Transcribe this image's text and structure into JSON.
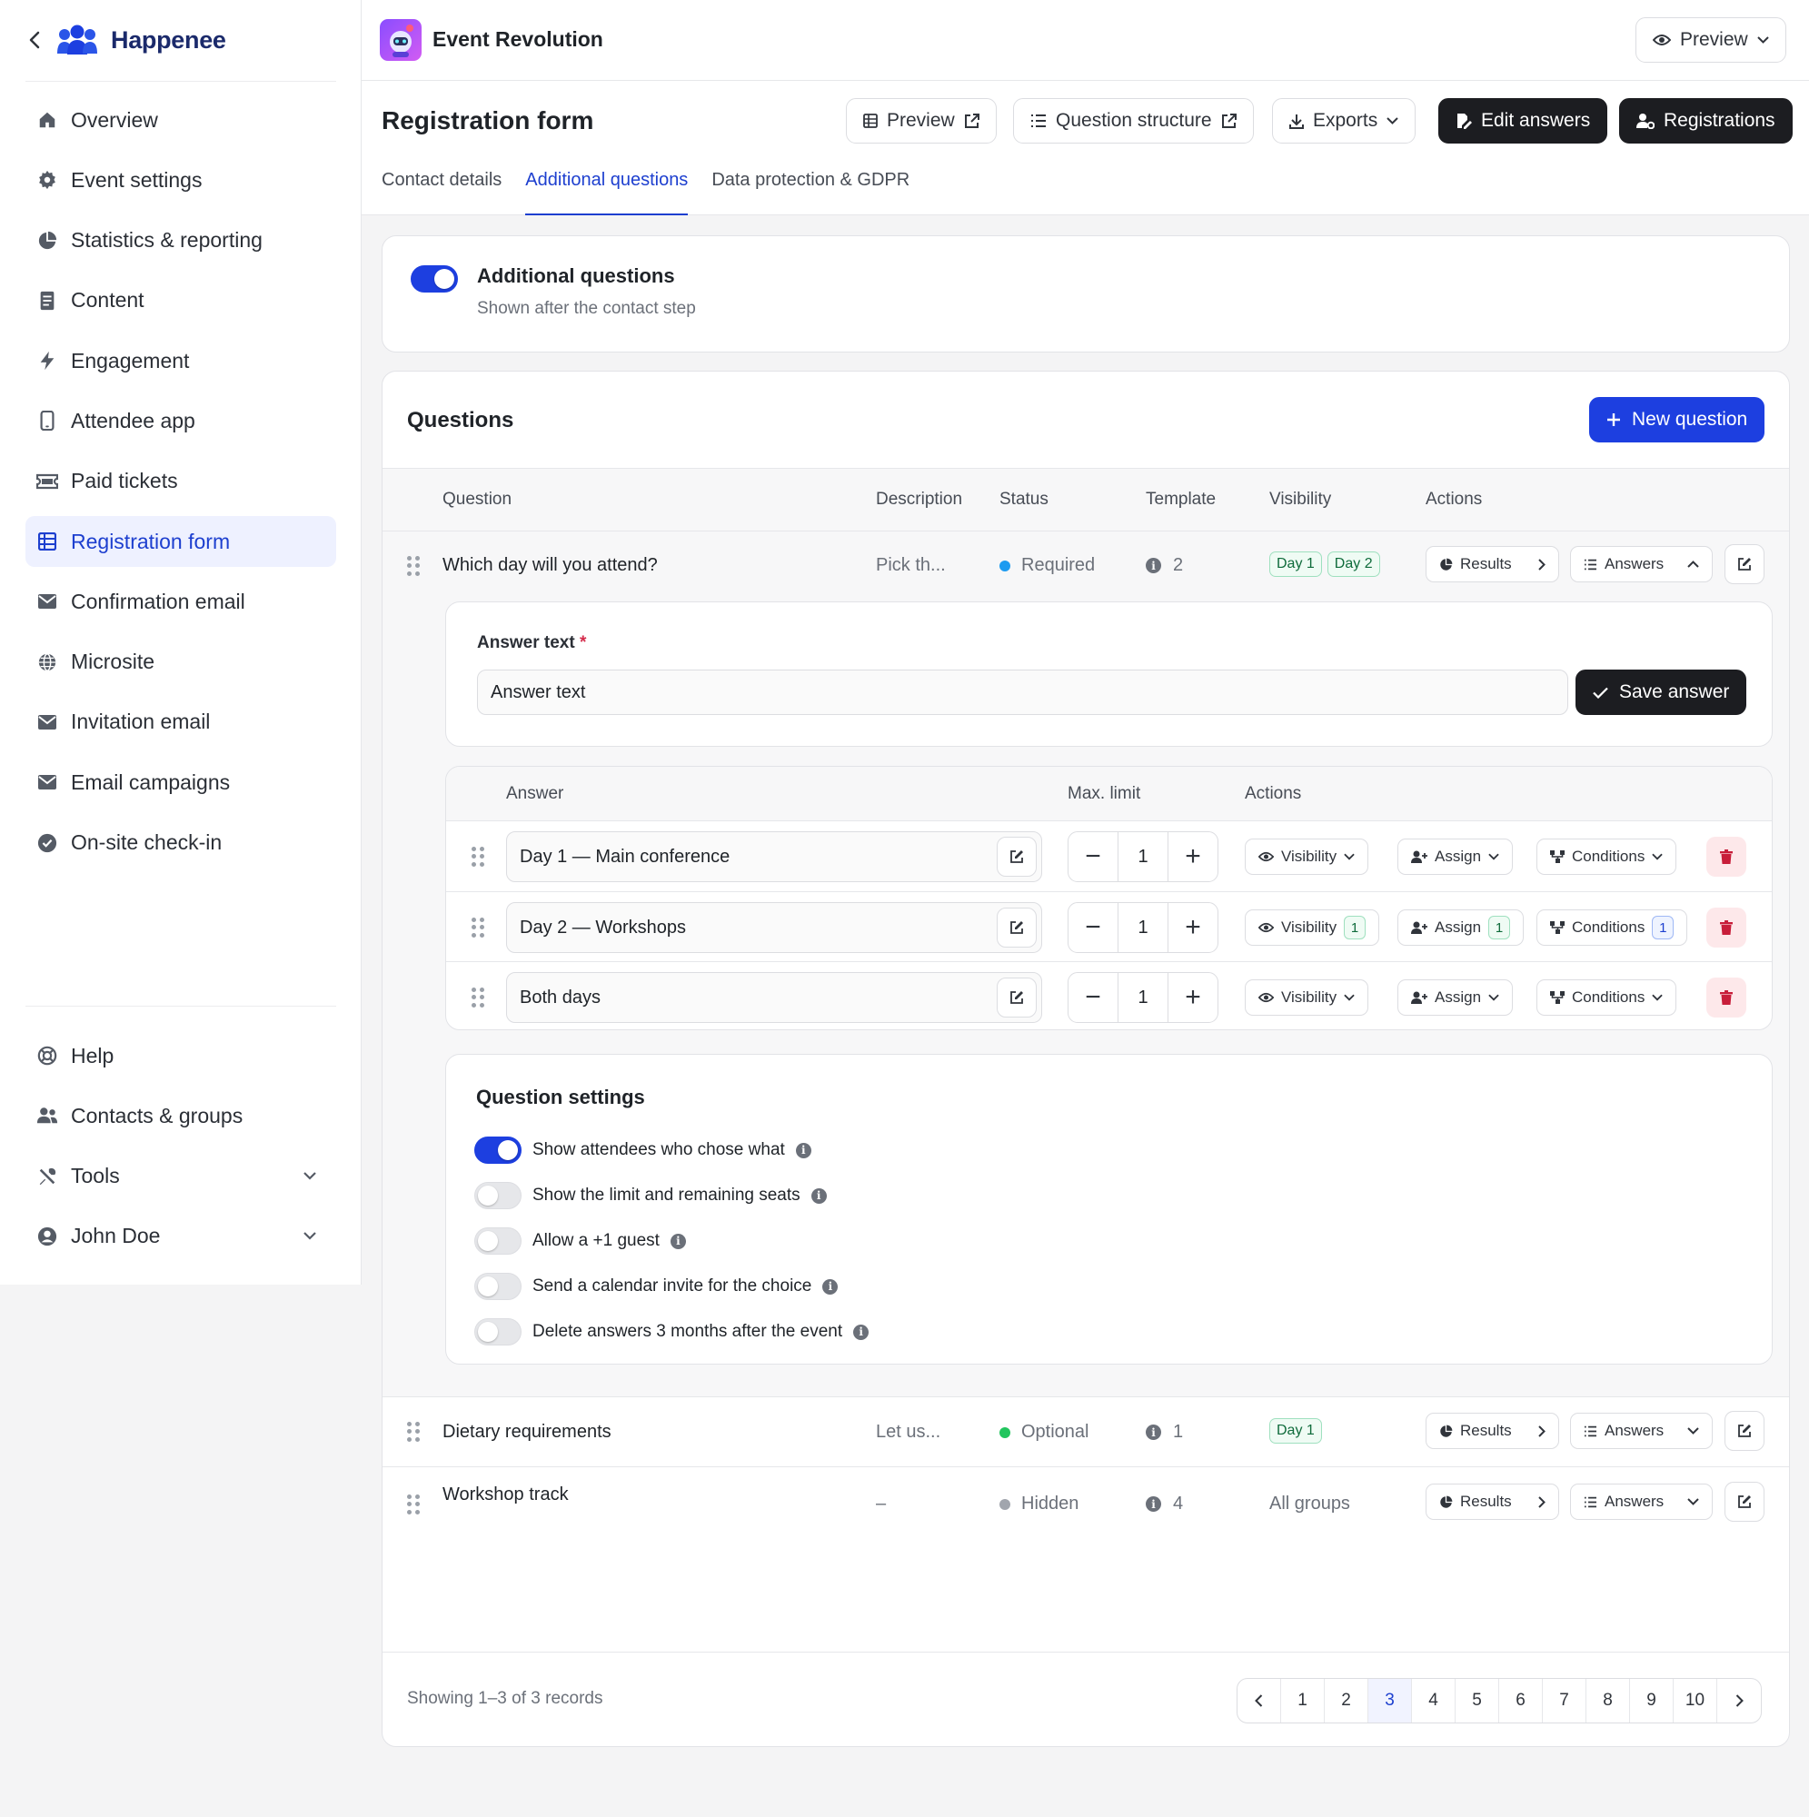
{
  "brand": {
    "name": "Happenee"
  },
  "sidebar": {
    "items": [
      {
        "label": "Overview",
        "icon": "home-icon"
      },
      {
        "label": "Event settings",
        "icon": "gear-icon"
      },
      {
        "label": "Statistics & reporting",
        "icon": "pie-chart-icon"
      },
      {
        "label": "Content",
        "icon": "document-icon"
      },
      {
        "label": "Engagement",
        "icon": "bolt-icon"
      },
      {
        "label": "Attendee app",
        "icon": "phone-icon"
      },
      {
        "label": "Paid tickets",
        "icon": "ticket-icon"
      },
      {
        "label": "Registration form",
        "icon": "table-icon",
        "active": true
      },
      {
        "label": "Confirmation email",
        "icon": "mail-icon"
      },
      {
        "label": "Microsite",
        "icon": "globe-icon"
      },
      {
        "label": "Invitation email",
        "icon": "mail-icon"
      },
      {
        "label": "Email campaigns",
        "icon": "mail-icon"
      },
      {
        "label": "On-site check-in",
        "icon": "check-circle-icon"
      }
    ],
    "bottom": [
      {
        "label": "Help",
        "icon": "lifebuoy-icon"
      },
      {
        "label": "Contacts & groups",
        "icon": "users-icon"
      },
      {
        "label": "Tools",
        "icon": "tools-icon"
      },
      {
        "label": "John Doe",
        "icon": "user-circle-icon"
      }
    ]
  },
  "topbar": {
    "event_name": "Event Revolution",
    "preview": "Preview"
  },
  "header": {
    "title": "Registration form",
    "buttons": {
      "preview": "Preview",
      "structure": "Question structure",
      "exports": "Exports",
      "edit_answers": "Edit answers",
      "registrations": "Registrations"
    },
    "tabs": [
      "Contact details",
      "Additional questions",
      "Data protection & GDPR"
    ]
  },
  "additional": {
    "title": "Additional questions",
    "subtitle": "Shown after the contact step",
    "enabled": true
  },
  "questions": {
    "title": "Questions",
    "new_button": "New question",
    "columns": [
      "Question",
      "Description",
      "Status",
      "Template",
      "Visibility",
      "Actions"
    ],
    "results_label": "Results",
    "answers_label": "Answers",
    "rows": [
      {
        "question": "Which day will you attend?",
        "description": "Pick th...",
        "status": "Required",
        "status_color": "#1d9bf0",
        "template": "2",
        "visibility": [
          "Day 1",
          "Day 2"
        ]
      },
      {
        "question": "Dietary requirements",
        "description": "Let us...",
        "status": "Optional",
        "status_color": "#22c55e",
        "template": "1",
        "visibility": [
          "Day 1"
        ]
      },
      {
        "question": "Workshop track",
        "description": "–",
        "status": "Hidden",
        "status_color": "#a1a5ad",
        "template": "4",
        "visibility_text": "All groups"
      }
    ]
  },
  "answer_form": {
    "label": "Answer text",
    "required_mark": "*",
    "placeholder": "Answer text",
    "save": "Save answer"
  },
  "answers": {
    "columns": [
      "Answer",
      "Max. limit",
      "Actions"
    ],
    "visibility": "Visibility",
    "assign": "Assign",
    "conditions": "Conditions",
    "rows": [
      {
        "text": "Day 1 — Main conference",
        "limit": "1"
      },
      {
        "text": "Day 2 — Workshops",
        "limit": "1",
        "visibility_count": "1",
        "assign_count": "1",
        "conditions_count": "1"
      },
      {
        "text": "Both days",
        "limit": "1"
      }
    ]
  },
  "settings": {
    "title": "Question settings",
    "items": [
      {
        "label": "Show attendees who chose what",
        "on": true
      },
      {
        "label": "Show the limit and remaining seats",
        "on": false
      },
      {
        "label": "Allow a +1 guest",
        "on": false
      },
      {
        "label": "Send a calendar invite for the choice",
        "on": false
      },
      {
        "label": "Delete answers 3 months after the event",
        "on": false
      }
    ]
  },
  "footer": {
    "showing": "Showing 1–3 of 3 records",
    "pages": [
      "1",
      "2",
      "3",
      "4",
      "5",
      "6",
      "7",
      "8",
      "9",
      "10"
    ],
    "current_page": "3"
  },
  "colors": {
    "accent": "#1d3fe0",
    "dark": "#1c1d21",
    "danger": "#c81e3a"
  }
}
